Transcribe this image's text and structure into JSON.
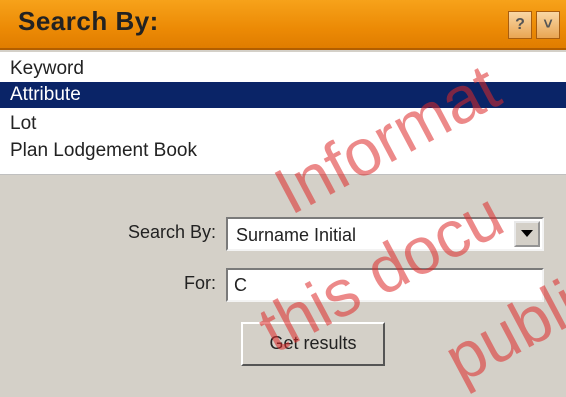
{
  "panel": {
    "title": "Search By:",
    "help_label": "?",
    "collapse_label": "˅"
  },
  "list": {
    "items": [
      "Keyword",
      "Attribute",
      "Lot",
      "Plan Lodgement Book"
    ],
    "selected": "Attribute"
  },
  "form": {
    "search_by_label": "Search By:",
    "search_by_value": "Surname Initial",
    "for_label": "For:",
    "for_value": "C",
    "submit_label": "Get results"
  },
  "watermark": {
    "lines": [
      "Informat",
      "this docu",
      "publi"
    ]
  },
  "colors": {
    "header": "#ec8a05",
    "selected_row": "#0a2467",
    "watermark": "#dc2828"
  }
}
